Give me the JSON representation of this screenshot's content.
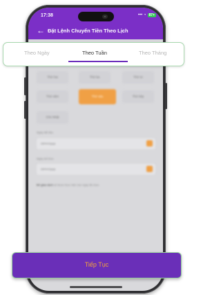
{
  "status_bar": {
    "time": "17:38",
    "signal_wifi": "••• ◔",
    "battery": "87+",
    "island_icon": "••"
  },
  "header": {
    "back_icon": "←",
    "title": "Đặt Lệnh Chuyển Tiền Theo Lịch"
  },
  "tabs": [
    {
      "label": "Theo Ngày",
      "active": false
    },
    {
      "label": "Theo Tuần",
      "active": true
    },
    {
      "label": "Theo Tháng",
      "active": false
    }
  ],
  "weekdays": [
    "Thứ hai",
    "Thứ ba",
    "Thứ tư",
    "Thứ năm",
    "Thứ sáu",
    "Thứ bảy",
    "Chủ Nhật"
  ],
  "selected_weekday": "Thứ sáu",
  "start_date": {
    "label": "Ngày bắt đầu",
    "value": "dd/mm/yyyy"
  },
  "end_date": {
    "label": "Ngày kết thúc",
    "value": "dd/mm/yyyy"
  },
  "note": {
    "prefix": "Để giao dịch",
    "text": "sẽ được thực hiện vào ngày đã chọn"
  },
  "cta": {
    "label": "Tiếp Tục"
  },
  "colors": {
    "brand_purple": "#7b2fc7",
    "accent_orange": "#f0a045",
    "highlight_green": "#a8d8ae"
  }
}
